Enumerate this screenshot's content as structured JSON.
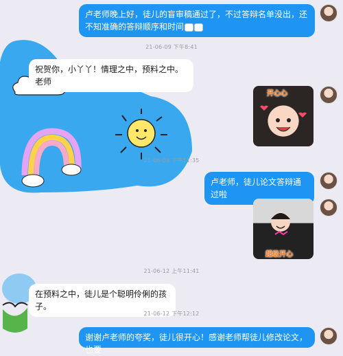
{
  "messages": {
    "m1": "卢老师晚上好，徒儿的盲审稿通过了，不过答辩名单没出，还不知准确的答辩顺序和时间",
    "m2": "祝贺你，小丫丫！情理之中，预料之中。老师",
    "m3": "卢老师，徒儿论文答辩通过啦",
    "m4": "在预料之中，徒儿是个聪明伶俐的孩子。",
    "m5": "谢谢卢老师的夸奖，徒儿很开心！感谢老师帮徒儿修改论文，也要"
  },
  "timestamps": {
    "t1": "21-06-09 下午8:41",
    "t2": "21-06-09 下午11:35",
    "t3": "21-06-12 上午11:41",
    "t4": "21-06-12 下午12:12"
  },
  "stickers": {
    "s1": "开心心",
    "s2": "超级开心"
  },
  "colors": {
    "sent_bubble": "#1e95f3",
    "received_bubble": "#ffffff",
    "doodle_blue": "#3aa8ee",
    "background": "#ecebf3"
  }
}
